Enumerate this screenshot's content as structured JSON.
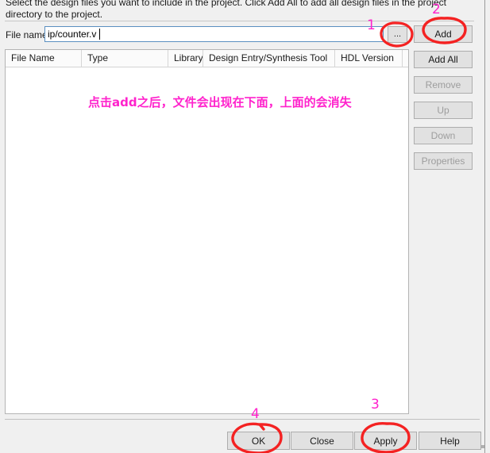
{
  "dialog": {
    "instructions": "Select the design files you want to include in the project. Click Add All to add all design files in the project directory to the project."
  },
  "filename_row": {
    "label": "File name:",
    "value": "ip/counter.v",
    "placeholder": "",
    "browse_label": "..."
  },
  "table": {
    "columns": [
      {
        "label": "File Name"
      },
      {
        "label": "Type"
      },
      {
        "label": "Library"
      },
      {
        "label": "Design Entry/Synthesis Tool"
      },
      {
        "label": "HDL Version"
      },
      {
        "label": ""
      }
    ],
    "rows": [],
    "overlay_note": "点击add之后，文件会出现在下面，上面的会消失"
  },
  "side_buttons": [
    {
      "label": "Add",
      "enabled": true
    },
    {
      "label": "Add All",
      "enabled": true
    },
    {
      "label": "Remove",
      "enabled": false
    },
    {
      "label": "Up",
      "enabled": false
    },
    {
      "label": "Down",
      "enabled": false
    },
    {
      "label": "Properties",
      "enabled": false
    }
  ],
  "bottom_buttons": {
    "ok": "OK",
    "close": "Close",
    "apply": "Apply",
    "help": "Help"
  },
  "annotations": {
    "colors": {
      "ink_red": "#f42222",
      "ink_magenta": "#ff22cc"
    },
    "numbers": {
      "one": "1",
      "two": "2",
      "three": "3",
      "four": "4"
    }
  }
}
